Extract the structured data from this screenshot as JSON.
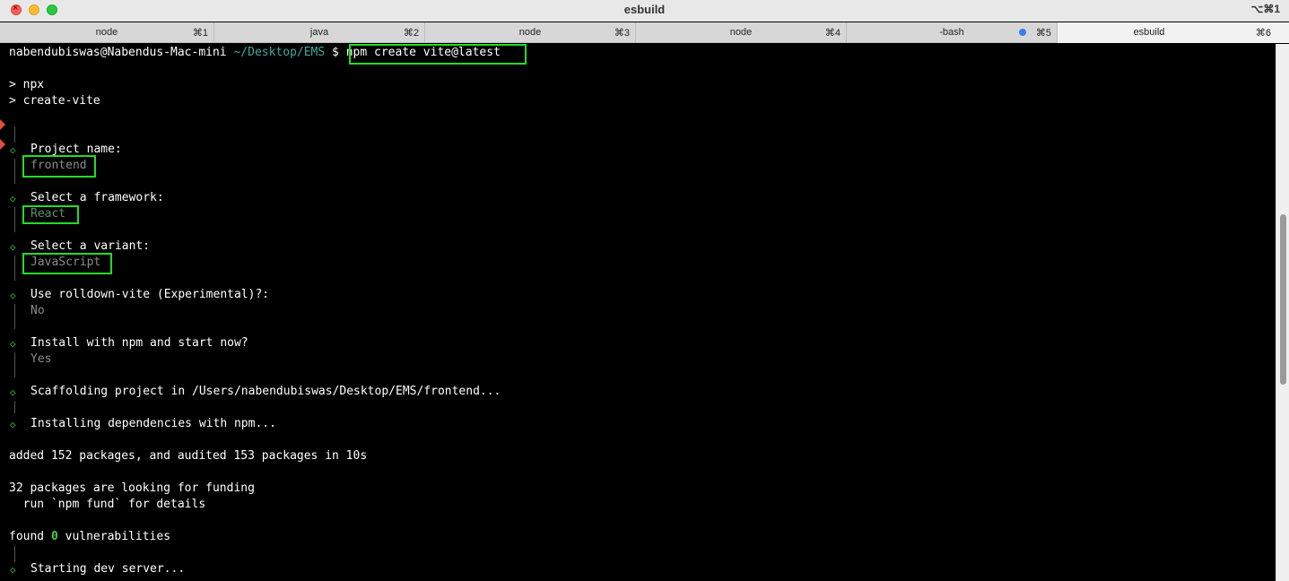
{
  "window": {
    "title": "esbuild",
    "shortcut": "⌥⌘1"
  },
  "tabs": [
    {
      "label": "node",
      "key": "⌘1"
    },
    {
      "label": "java",
      "key": "⌘2"
    },
    {
      "label": "node",
      "key": "⌘3"
    },
    {
      "label": "node",
      "key": "⌘4"
    },
    {
      "label": "-bash",
      "key": "⌘5"
    },
    {
      "label": "esbuild",
      "key": "⌘6"
    }
  ],
  "terminal": {
    "prompt_user": "nabendubiswas@Nabendus-Mac-mini",
    "prompt_path": "~/Desktop/EMS",
    "prompt_symbol": "$",
    "command": "npm create vite@latest",
    "npx_line": "> npx",
    "create_vite_line": "> create-vite",
    "q_project": "Project name:",
    "a_project": "frontend",
    "q_framework": "Select a framework:",
    "a_framework": "React",
    "q_variant": "Select a variant:",
    "a_variant": "JavaScript",
    "q_rolldown": "Use rolldown-vite (Experimental)?:",
    "a_rolldown": "No",
    "q_install": "Install with npm and start now?",
    "a_install": "Yes",
    "scaffolding": "Scaffolding project in /Users/nabendubiswas/Desktop/EMS/frontend...",
    "installing": "Installing dependencies with npm...",
    "added": "added 152 packages, and audited 153 packages in 10s",
    "funding": "32 packages are looking for funding",
    "fund_hint": "  run `npm fund` for details",
    "found_prefix": "found",
    "found_count": "0",
    "found_suffix": "vulnerabilities",
    "starting": "Starting dev server..."
  },
  "colors": {
    "highlight": "#22dd22",
    "accent_green": "#3fb950",
    "tab_dot": "#3b7cf0"
  }
}
